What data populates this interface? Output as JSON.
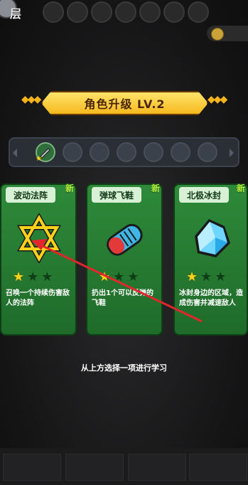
{
  "top": {
    "level_label": "层",
    "slot_count": 7
  },
  "banner": {
    "title": "角色升级 LV.2"
  },
  "skill_bar": {
    "slots": [
      {
        "filled": true,
        "icon": "sword-icon"
      },
      {
        "filled": false
      },
      {
        "filled": false
      },
      {
        "filled": false
      },
      {
        "filled": false
      },
      {
        "filled": false
      },
      {
        "filled": false
      }
    ]
  },
  "cards": [
    {
      "title": "波动法阵",
      "badge": "新",
      "icon": "hexagram-icon",
      "stars": 1,
      "max_stars": 3,
      "description": "召唤一个持续伤害敌人的法阵"
    },
    {
      "title": "弹球飞鞋",
      "badge": "新",
      "icon": "shoe-icon",
      "stars": 1,
      "max_stars": 3,
      "description": "扔出1个可以反弹的飞鞋"
    },
    {
      "title": "北极冰封",
      "badge": "新",
      "icon": "ice-crystal-icon",
      "stars": 1,
      "max_stars": 3,
      "description": "冰封身边的区域，造成伤害并减速敌人"
    }
  ],
  "hint": "从上方选择一项进行学习",
  "colors": {
    "card_green": "#2e8a3a",
    "banner_gold": "#f6b91d",
    "arrow_red": "#e2262c"
  }
}
